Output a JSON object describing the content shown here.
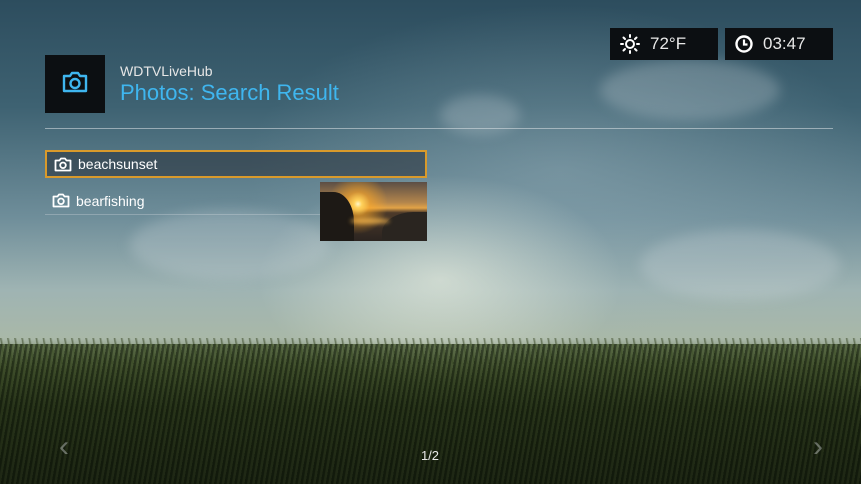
{
  "status_bar": {
    "weather_icon": "sun-icon",
    "temperature": "72°F",
    "clock_icon": "clock-icon",
    "time": "03:47"
  },
  "header": {
    "icon": "camera-icon",
    "app_name": "WDTVLiveHub",
    "title": "Photos: Search Result"
  },
  "results": [
    {
      "icon": "camera-icon",
      "label": "beachsunset",
      "selected": true
    },
    {
      "icon": "camera-icon",
      "label": "bearfishing",
      "selected": false
    }
  ],
  "preview": {
    "for": "beachsunset"
  },
  "navigation": {
    "prev_icon": "chevron-left-icon",
    "next_icon": "chevron-right-icon",
    "page_indicator": "1/2"
  },
  "colors": {
    "accent_title": "#3fb6ef",
    "selection_border": "#d99a2b"
  }
}
